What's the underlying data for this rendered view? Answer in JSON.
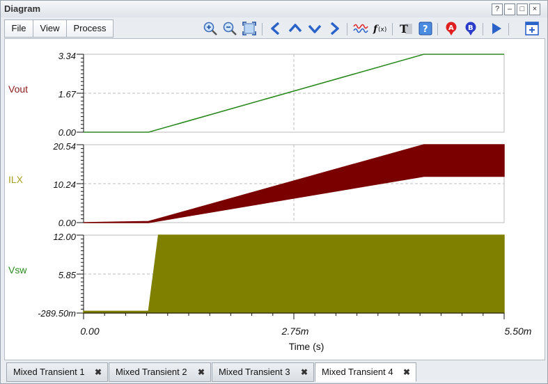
{
  "window": {
    "title": "Diagram",
    "help": "?",
    "minimize": "–",
    "maximize": "□",
    "close": "×"
  },
  "menu": {
    "file": "File",
    "view": "View",
    "process": "Process"
  },
  "plots": {
    "vout": {
      "label": "Vout",
      "ticks": [
        "3.34",
        "1.67",
        "0.00"
      ],
      "color": "#2a8a1e"
    },
    "ilx": {
      "label": "ILX",
      "ticks": [
        "20.54",
        "10.24",
        "0.00"
      ],
      "color": "#7a0000"
    },
    "vsw": {
      "label": "Vsw",
      "ticks": [
        "12.00",
        "5.85",
        "-289.50m"
      ],
      "color": "#808000"
    }
  },
  "xaxis": {
    "ticks": [
      "0.00",
      "2.75m",
      "5.50m"
    ],
    "title": "Time (s)"
  },
  "tabs": [
    {
      "label": "Mixed Transient 1"
    },
    {
      "label": "Mixed Transient 2"
    },
    {
      "label": "Mixed Transient 3"
    },
    {
      "label": "Mixed Transient 4"
    }
  ],
  "chart_data": [
    {
      "type": "line",
      "name": "Vout",
      "x": [
        0,
        0.00085,
        0.00445,
        0.0055
      ],
      "y": [
        0,
        0,
        3.34,
        3.34
      ],
      "ylim": [
        0,
        3.34
      ],
      "xlim": [
        0,
        0.0055
      ],
      "grid": true
    },
    {
      "type": "area",
      "name": "ILX",
      "x": [
        0,
        0.00085,
        0.00445,
        0.0055
      ],
      "y_max": [
        0,
        0.3,
        20.54,
        20.54
      ],
      "y_min": [
        0,
        0,
        12.2,
        12.2
      ],
      "ylim": [
        0,
        20.54
      ],
      "xlim": [
        0,
        0.0055
      ],
      "grid": true
    },
    {
      "type": "area",
      "name": "Vsw",
      "x": [
        0,
        0.00085,
        0.00098,
        0.0055
      ],
      "y_max": [
        0,
        0,
        12.0,
        12.0
      ],
      "y_min": [
        -0.2895,
        -0.2895,
        -0.2895,
        -0.2895
      ],
      "ylim": [
        -0.2895,
        12.0
      ],
      "xlim": [
        0,
        0.0055
      ],
      "grid": true
    }
  ]
}
